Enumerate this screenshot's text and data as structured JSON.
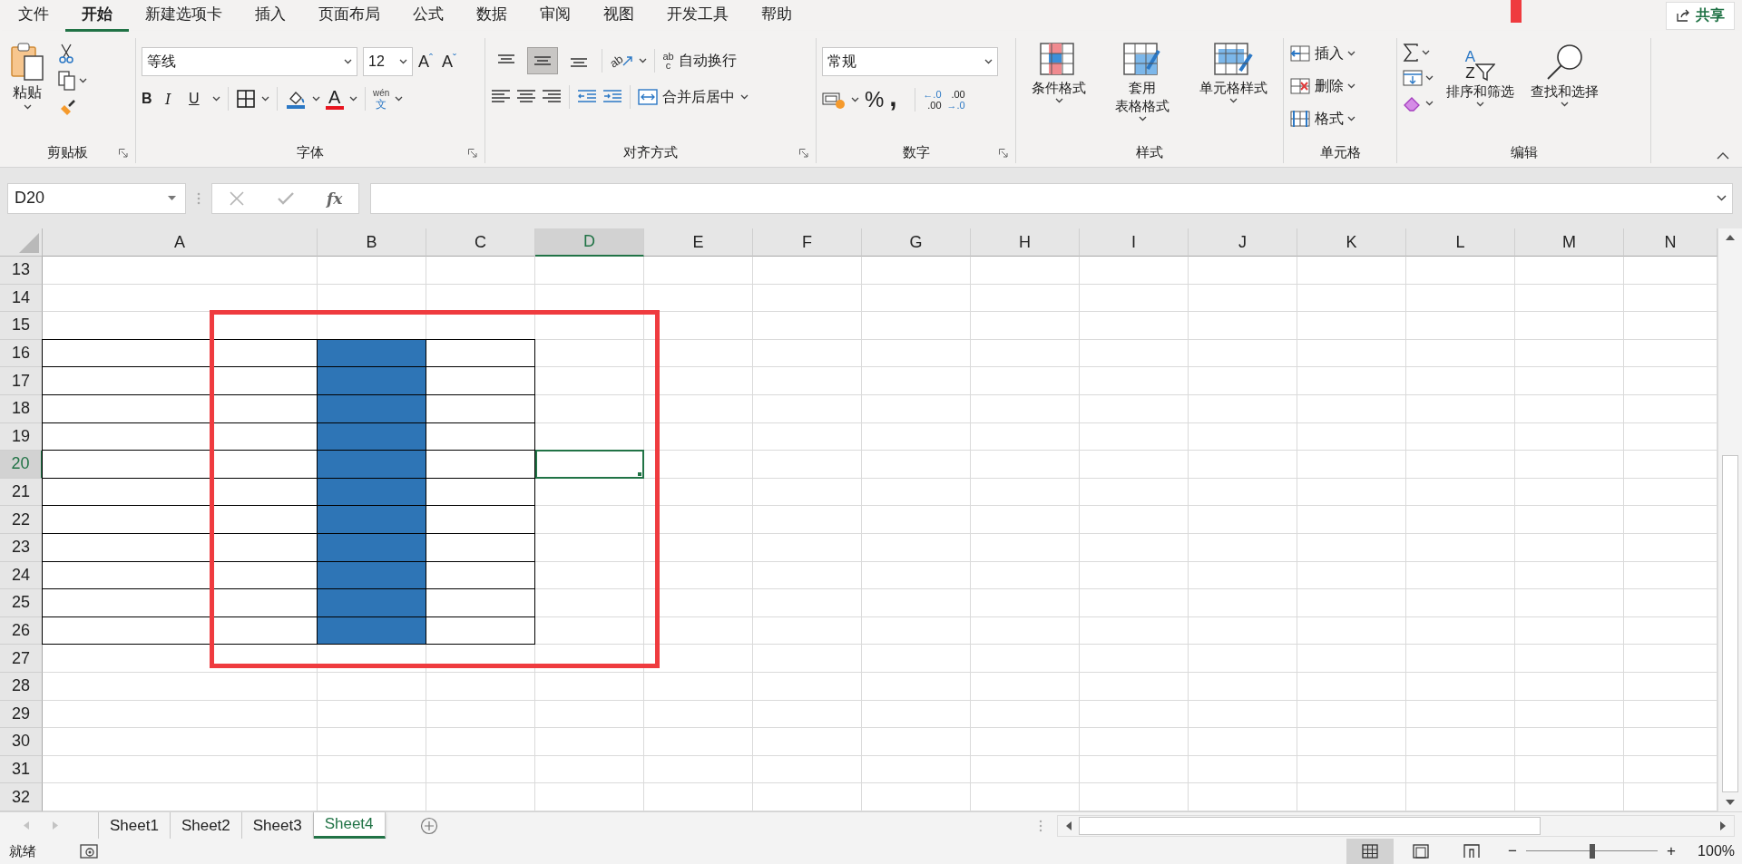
{
  "menu_tabs": [
    {
      "label": "文件",
      "selected": false
    },
    {
      "label": "开始",
      "selected": true
    },
    {
      "label": "新建选项卡",
      "selected": false
    },
    {
      "label": "插入",
      "selected": false
    },
    {
      "label": "页面布局",
      "selected": false
    },
    {
      "label": "公式",
      "selected": false
    },
    {
      "label": "数据",
      "selected": false
    },
    {
      "label": "审阅",
      "selected": false
    },
    {
      "label": "视图",
      "selected": false
    },
    {
      "label": "开发工具",
      "selected": false
    },
    {
      "label": "帮助",
      "selected": false
    }
  ],
  "share_button": "共享",
  "ribbon": {
    "clipboard": {
      "paste": "粘贴",
      "group": "剪贴板"
    },
    "font": {
      "family": "等线",
      "size": "12",
      "grow": "A",
      "grow_mark": "ˆ",
      "shrink": "A",
      "shrink_mark": "ˇ",
      "bold": "B",
      "italic": "I",
      "underline": "U",
      "font_color": "A",
      "phonetic_top": "wén",
      "phonetic_bottom": "文",
      "group": "字体"
    },
    "alignment": {
      "vertical_align": [
        {
          "kind": "top",
          "selected": false
        },
        {
          "kind": "middle",
          "selected": true
        },
        {
          "kind": "bottom",
          "selected": false
        }
      ],
      "orientation": "ab",
      "wrap_icon_top": "ab",
      "wrap_icon_bottom": "c",
      "wrap_text": "自动换行",
      "merge_center": "合并后居中",
      "group": "对齐方式"
    },
    "number": {
      "format": "常规",
      "percent": "%",
      "comma": ",",
      "increase_decimal": [
        "←.0",
        ".00"
      ],
      "decrease_decimal": [
        ".00",
        "→.0"
      ],
      "group": "数字"
    },
    "styles": {
      "buttons": [
        {
          "kind": "conditional",
          "lines": [
            "条件格式"
          ]
        },
        {
          "kind": "table",
          "lines": [
            "套用",
            "表格格式"
          ]
        },
        {
          "kind": "cell",
          "lines": [
            "单元格样式"
          ]
        }
      ],
      "group": "样式"
    },
    "cells": {
      "buttons": [
        {
          "kind": "insert",
          "label": "插入"
        },
        {
          "kind": "delete",
          "label": "删除"
        },
        {
          "kind": "format",
          "label": "格式"
        }
      ],
      "group": "单元格"
    },
    "editing": {
      "sort_letters": [
        "A",
        "Z"
      ],
      "sort_filter": "排序和筛选",
      "find_select": "查找和选择",
      "group": "编辑"
    }
  },
  "formula_bar": {
    "name_box": "D20",
    "function_label": "fx"
  },
  "sheet": {
    "columns": [
      {
        "label": "A",
        "selected": false
      },
      {
        "label": "B",
        "selected": false
      },
      {
        "label": "C",
        "selected": false
      },
      {
        "label": "D",
        "selected": true
      },
      {
        "label": "E",
        "selected": false
      },
      {
        "label": "F",
        "selected": false
      },
      {
        "label": "G",
        "selected": false
      },
      {
        "label": "H",
        "selected": false
      },
      {
        "label": "I",
        "selected": false
      },
      {
        "label": "J",
        "selected": false
      },
      {
        "label": "K",
        "selected": false
      },
      {
        "label": "L",
        "selected": false
      },
      {
        "label": "M",
        "selected": false
      },
      {
        "label": "N",
        "selected": false
      }
    ],
    "rows": [
      {
        "label": "13",
        "selected": false
      },
      {
        "label": "14",
        "selected": false
      },
      {
        "label": "15",
        "selected": false
      },
      {
        "label": "16",
        "selected": false,
        "cells": [
          {
            "filled": false
          },
          {
            "filled": true
          },
          {
            "filled": false
          }
        ]
      },
      {
        "label": "17",
        "selected": false,
        "cells": [
          {
            "filled": false
          },
          {
            "filled": true
          },
          {
            "filled": false
          }
        ]
      },
      {
        "label": "18",
        "selected": false,
        "cells": [
          {
            "filled": false
          },
          {
            "filled": true
          },
          {
            "filled": false
          }
        ]
      },
      {
        "label": "19",
        "selected": false,
        "cells": [
          {
            "filled": false
          },
          {
            "filled": true
          },
          {
            "filled": false
          }
        ]
      },
      {
        "label": "20",
        "selected": true,
        "cells": [
          {
            "filled": false
          },
          {
            "filled": true
          },
          {
            "filled": false
          }
        ]
      },
      {
        "label": "21",
        "selected": false,
        "cells": [
          {
            "filled": false
          },
          {
            "filled": true
          },
          {
            "filled": false
          }
        ]
      },
      {
        "label": "22",
        "selected": false,
        "cells": [
          {
            "filled": false
          },
          {
            "filled": true
          },
          {
            "filled": false
          }
        ]
      },
      {
        "label": "23",
        "selected": false,
        "cells": [
          {
            "filled": false
          },
          {
            "filled": true
          },
          {
            "filled": false
          }
        ]
      },
      {
        "label": "24",
        "selected": false,
        "cells": [
          {
            "filled": false
          },
          {
            "filled": true
          },
          {
            "filled": false
          }
        ]
      },
      {
        "label": "25",
        "selected": false,
        "cells": [
          {
            "filled": false
          },
          {
            "filled": true
          },
          {
            "filled": false
          }
        ]
      },
      {
        "label": "26",
        "selected": false,
        "cells": [
          {
            "filled": false
          },
          {
            "filled": true
          },
          {
            "filled": false
          }
        ]
      },
      {
        "label": "27",
        "selected": false
      },
      {
        "label": "28",
        "selected": false
      },
      {
        "label": "29",
        "selected": false
      },
      {
        "label": "30",
        "selected": false
      },
      {
        "label": "31",
        "selected": false
      },
      {
        "label": "32",
        "selected": false
      }
    ]
  },
  "sheet_tabs": [
    {
      "label": "Sheet1",
      "selected": false
    },
    {
      "label": "Sheet2",
      "selected": false
    },
    {
      "label": "Sheet3",
      "selected": false
    },
    {
      "label": "Sheet4",
      "selected": true
    }
  ],
  "status": {
    "text": "就绪",
    "views": [
      {
        "kind": "normal",
        "selected": true
      },
      {
        "kind": "page_layout",
        "selected": false
      },
      {
        "kind": "page_break",
        "selected": false
      }
    ],
    "zoom_out": "−",
    "zoom_slider": {
      "level": 0.5
    },
    "zoom_in": "+",
    "zoom": "100%"
  },
  "annotations": {
    "frame_shown": true,
    "marker_shown": true
  }
}
